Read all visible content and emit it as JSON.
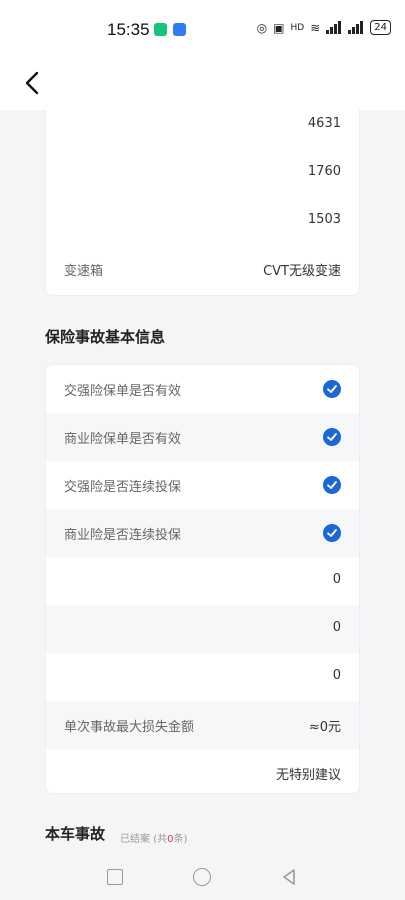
{
  "status_bar": {
    "time": "15:35",
    "battery": "24",
    "right_icons": [
      "location-icon",
      "vibrate-icon",
      "hd-icon",
      "wifi-icon",
      "signal-icon",
      "signal-icon"
    ]
  },
  "header": {
    "back_icon": "chevron-left-icon"
  },
  "vehicle_info": {
    "rows": [
      {
        "label": "",
        "value": "4631"
      },
      {
        "label": "",
        "value": "1760"
      },
      {
        "label": "",
        "value": "1503"
      },
      {
        "label": "变速箱",
        "value": "CVT无级变速"
      }
    ]
  },
  "insurance": {
    "title": "保险事故基本信息",
    "check_rows": [
      {
        "label": "交强险保单是否有效",
        "checked": true
      },
      {
        "label": "商业险保单是否有效",
        "checked": true
      },
      {
        "label": "交强险是否连续投保",
        "checked": true
      },
      {
        "label": "商业险是否连续投保",
        "checked": true
      }
    ],
    "value_rows": [
      {
        "label": "",
        "value": "0"
      },
      {
        "label": "",
        "value": "0"
      },
      {
        "label": "",
        "value": "0"
      },
      {
        "label": "单次事故最大损失金额",
        "value": "≈0元"
      },
      {
        "label": "",
        "value": "无特别建议"
      }
    ]
  },
  "accident": {
    "title": "本车事故",
    "status": "已结案",
    "count_prefix": "(共",
    "count": "0",
    "count_suffix": "条)"
  },
  "colors": {
    "accent": "#1a68d6",
    "count_red": "#e23b3b"
  }
}
